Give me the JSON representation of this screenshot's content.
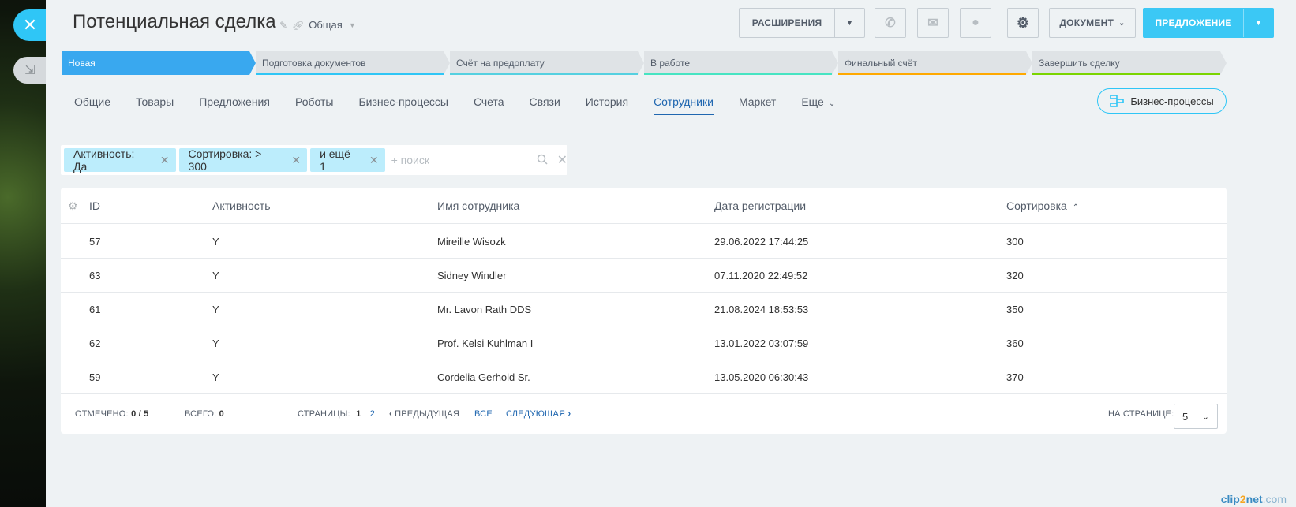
{
  "page": {
    "title": "Потенциальная сделка",
    "category": "Общая"
  },
  "toolbar": {
    "extensions_label": "РАСШИРЕНИЯ",
    "document_label": "ДОКУМЕНТ",
    "offer_label": "ПРЕДЛОЖЕНИЕ"
  },
  "stages": [
    {
      "label": "Новая",
      "color": "#39a8ef"
    },
    {
      "label": "Подготовка документов",
      "color": "#2fc6f6"
    },
    {
      "label": "Счёт на предоплату",
      "color": "#55d0e0"
    },
    {
      "label": "В работе",
      "color": "#47e4c2"
    },
    {
      "label": "Финальный счёт",
      "color": "#ffa900"
    },
    {
      "label": "Завершить сделку",
      "color": "#7bd500"
    }
  ],
  "tabs": [
    {
      "label": "Общие"
    },
    {
      "label": "Товары"
    },
    {
      "label": "Предложения"
    },
    {
      "label": "Роботы"
    },
    {
      "label": "Бизнес-процессы"
    },
    {
      "label": "Счета"
    },
    {
      "label": "Связи"
    },
    {
      "label": "История"
    },
    {
      "label": "Сотрудники",
      "active": true
    },
    {
      "label": "Маркет"
    },
    {
      "label": "Еще"
    }
  ],
  "bp_button_label": "Бизнес-процессы",
  "filter": {
    "chips": [
      "Активность: Да",
      "Сортировка: > 300",
      "и ещё 1"
    ],
    "placeholder": "+ поиск"
  },
  "grid": {
    "columns": [
      "ID",
      "Активность",
      "Имя сотрудника",
      "Дата регистрации",
      "Сортировка"
    ],
    "rows": [
      {
        "id": "57",
        "active": "Y",
        "name": "Mireille Wisozk",
        "date": "29.06.2022 17:44:25",
        "sort": "300"
      },
      {
        "id": "63",
        "active": "Y",
        "name": "Sidney Windler",
        "date": "07.11.2020 22:49:52",
        "sort": "320"
      },
      {
        "id": "61",
        "active": "Y",
        "name": "Mr. Lavon Rath DDS",
        "date": "21.08.2024 18:53:53",
        "sort": "350"
      },
      {
        "id": "62",
        "active": "Y",
        "name": "Prof. Kelsi Kuhlman I",
        "date": "13.01.2022 03:07:59",
        "sort": "360"
      },
      {
        "id": "59",
        "active": "Y",
        "name": "Cordelia Gerhold Sr.",
        "date": "13.05.2020 06:30:43",
        "sort": "370"
      }
    ]
  },
  "footer": {
    "selected_label": "ОТМЕЧЕНО:",
    "selected_value": "0 / 5",
    "total_label": "ВСЕГО:",
    "total_value": "0",
    "pages_label": "СТРАНИЦЫ:",
    "page_current": "1",
    "page_next": "2",
    "prev_label": "ПРЕДЫДУЩАЯ",
    "all_label": "ВСЕ",
    "next_label": "СЛЕДУЮЩАЯ",
    "per_page_label": "НА СТРАНИЦЕ:",
    "per_page_value": "5"
  },
  "watermark": {
    "part1": "clip",
    "part2": "2",
    "part3": "net",
    "suffix": ".com"
  }
}
